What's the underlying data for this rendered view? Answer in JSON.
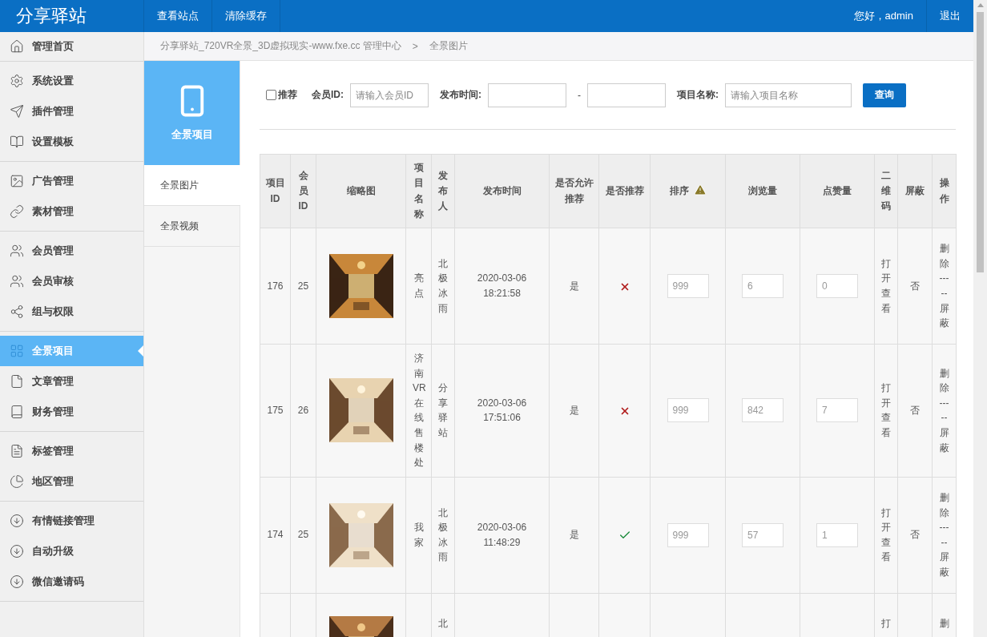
{
  "header": {
    "logo": "分享驿站",
    "nav": [
      "查看站点",
      "清除缓存"
    ],
    "greeting": "您好，admin",
    "logout": "退出"
  },
  "sidebar": {
    "groups": [
      {
        "items": [
          {
            "label": "管理首页",
            "selected": false
          }
        ]
      },
      {
        "items": [
          {
            "label": "系统设置",
            "selected": false
          },
          {
            "label": "插件管理",
            "selected": false
          },
          {
            "label": "设置模板",
            "selected": false
          }
        ]
      },
      {
        "items": [
          {
            "label": "广告管理",
            "selected": false
          },
          {
            "label": "素材管理",
            "selected": false
          }
        ]
      },
      {
        "items": [
          {
            "label": "会员管理",
            "selected": false
          },
          {
            "label": "会员审核",
            "selected": false
          },
          {
            "label": "组与权限",
            "selected": false
          }
        ]
      },
      {
        "items": [
          {
            "label": "全景项目",
            "selected": true
          },
          {
            "label": "文章管理",
            "selected": false
          },
          {
            "label": "财务管理",
            "selected": false
          }
        ]
      },
      {
        "items": [
          {
            "label": "标签管理",
            "selected": false
          },
          {
            "label": "地区管理",
            "selected": false
          }
        ]
      },
      {
        "items": [
          {
            "label": "有情链接管理",
            "selected": false
          },
          {
            "label": "自动升级",
            "selected": false
          },
          {
            "label": "微信邀请码",
            "selected": false
          }
        ]
      }
    ]
  },
  "breadcrumb": {
    "path": "分享驿站_720VR全景_3D虚拟现实-www.fxe.cc 管理中心",
    "separator": ">",
    "current": "全景图片"
  },
  "subnav": {
    "title": "全景项目",
    "items": [
      {
        "label": "全景图片",
        "selected": true
      },
      {
        "label": "全景视频",
        "selected": false
      }
    ]
  },
  "filter": {
    "recommend": {
      "label": "推荐",
      "checked": false
    },
    "member_label": "会员ID:",
    "member_placeholder": "请输入会员ID",
    "time_label": "发布时间:",
    "time_separator": "-",
    "name_label": "项目名称:",
    "name_placeholder": "请输入项目名称",
    "button": "查询"
  },
  "table": {
    "columns": [
      "项目ID",
      "会员ID",
      "缩略图",
      "项目名称",
      "发布人",
      "发布时间",
      "是否允许推荐",
      "是否推荐",
      "排序",
      "浏览量",
      "点赞量",
      "二维码",
      "屏蔽",
      "操作"
    ],
    "rows": [
      {
        "kind": "full",
        "id": "176",
        "member": "25",
        "thumbnail": {
          "kind": "picture"
        },
        "name": "亮点",
        "publisher": "北极冰雨",
        "date": "2020-03-06",
        "time": "18:21:58",
        "allow": "是",
        "recommended": false,
        "sort": "999",
        "views": "6",
        "likes": "0",
        "qr": "打开查看",
        "shield": "否",
        "ops": [
          "删除",
          "-----",
          "屏蔽"
        ]
      },
      {
        "kind": "full",
        "id": "175",
        "member": "26",
        "thumbnail": {
          "kind": "picture"
        },
        "name": "济南VR在线售楼处",
        "publisher": "分享驿站",
        "date": "2020-03-06",
        "time": "17:51:06",
        "allow": "是",
        "recommended": false,
        "sort": "999",
        "views": "842",
        "likes": "7",
        "qr": "打开查看",
        "shield": "否",
        "ops": [
          "删除",
          "-----",
          "屏蔽"
        ]
      },
      {
        "kind": "full",
        "id": "174",
        "member": "25",
        "thumbnail": {
          "kind": "picture"
        },
        "name": "我家",
        "publisher": "北极冰雨",
        "date": "2020-03-06",
        "time": "11:48:29",
        "allow": "是",
        "recommended": true,
        "sort": "999",
        "views": "57",
        "likes": "1",
        "qr": "打开查看",
        "shield": "否",
        "ops": [
          "删除",
          "-----",
          "屏蔽"
        ]
      },
      {
        "kind": "partial",
        "thumbnail": {
          "kind": "picture"
        },
        "publisher": "北",
        "qr": "打",
        "ops": [
          "删"
        ]
      }
    ]
  }
}
